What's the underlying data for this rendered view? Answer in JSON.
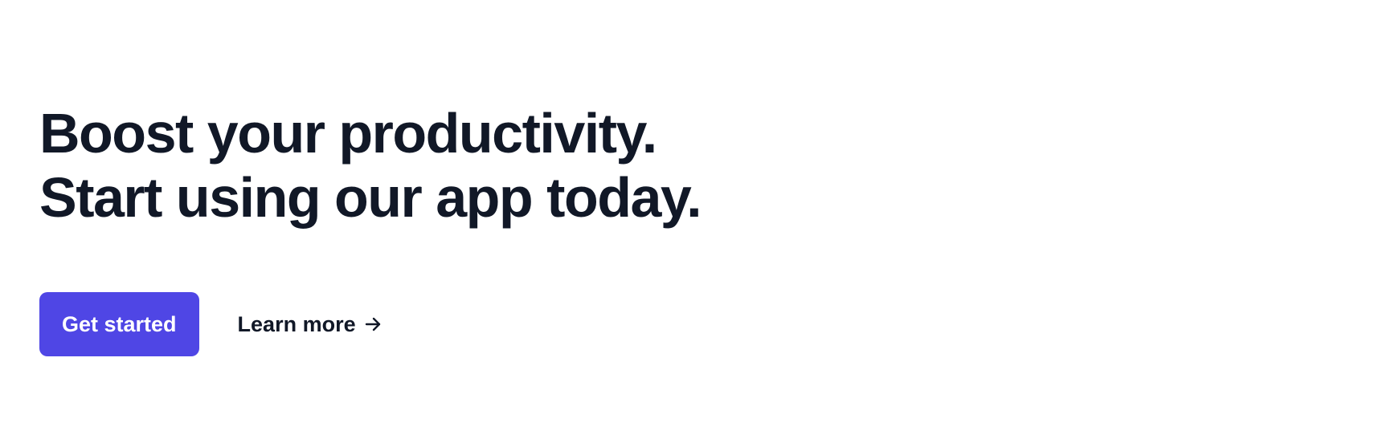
{
  "hero": {
    "headline_line1": "Boost your productivity.",
    "headline_line2": "Start using our app today.",
    "primary_cta": "Get started",
    "secondary_cta": "Learn more",
    "secondary_icon": "arrow-right-icon"
  },
  "colors": {
    "text": "#111827",
    "accent": "#4f46e5",
    "background": "#ffffff"
  }
}
